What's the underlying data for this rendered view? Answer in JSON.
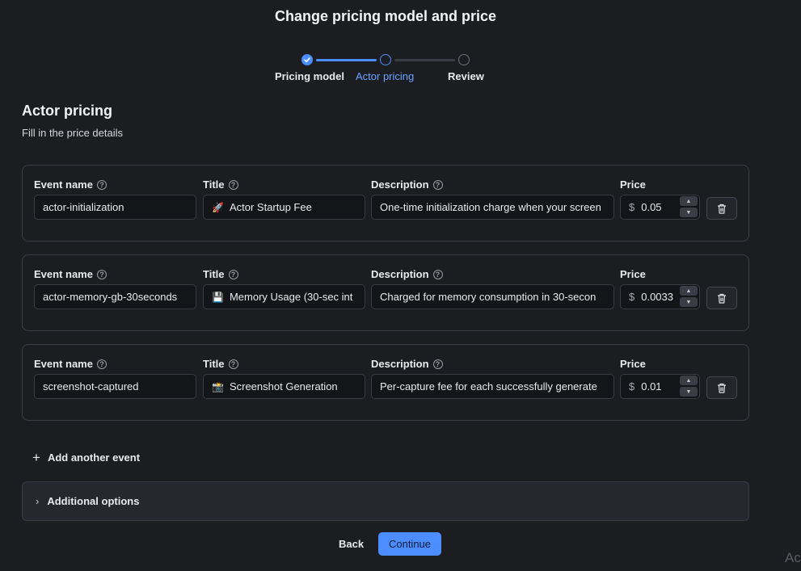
{
  "dialog": {
    "title": "Change pricing model and price"
  },
  "stepper": {
    "steps": [
      {
        "label": "Pricing model",
        "state": "done"
      },
      {
        "label": "Actor pricing",
        "state": "active"
      },
      {
        "label": "Review",
        "state": "todo"
      }
    ]
  },
  "section": {
    "title": "Actor pricing",
    "subtitle": "Fill in the price details"
  },
  "labels": {
    "event_name": "Event name",
    "title": "Title",
    "description": "Description",
    "price": "Price",
    "currency": "$"
  },
  "events": [
    {
      "event_name": "actor-initialization",
      "title_emoji": "🚀",
      "title": "Actor Startup Fee",
      "description": "One-time initialization charge when your screen",
      "price": "0.05"
    },
    {
      "event_name": "actor-memory-gb-30seconds",
      "title_emoji": "💾",
      "title": "Memory Usage (30-sec int",
      "description": "Charged for memory consumption in 30-secon",
      "price": "0.0033"
    },
    {
      "event_name": "screenshot-captured",
      "title_emoji": "📸",
      "title": "Screenshot Generation",
      "description": "Per-capture fee for each successfully generate",
      "price": "0.01"
    }
  ],
  "add_event_label": "Add another event",
  "additional_options_label": "Additional options",
  "footer": {
    "back_label": "Back",
    "continue_label": "Continue"
  },
  "watermark": "Ac",
  "colors": {
    "accent": "#4c8dff",
    "background": "#1c1d21"
  }
}
